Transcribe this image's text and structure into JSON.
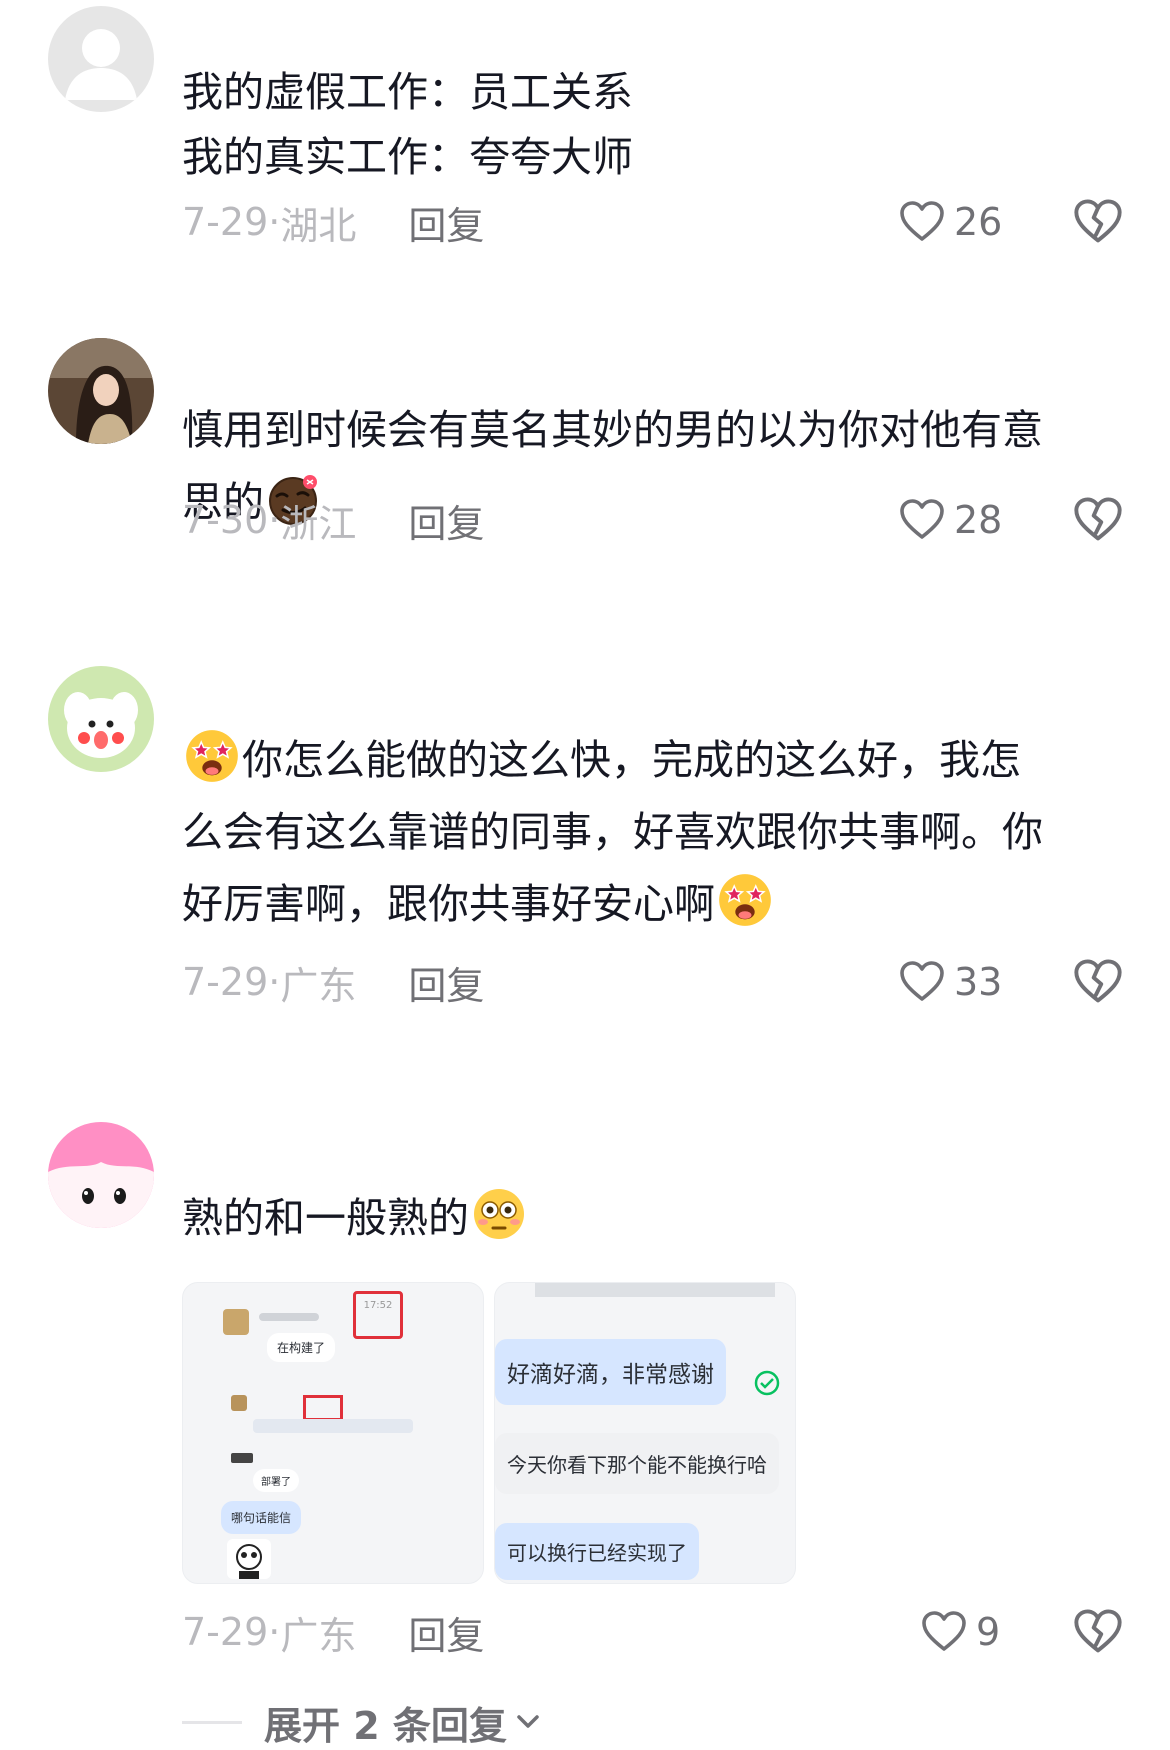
{
  "comments": [
    {
      "lines": [
        "我的虚假工作：员工关系",
        "我的真实工作：夸夸大师"
      ],
      "date": "7-29",
      "location": "湖北",
      "reply_label": "回复",
      "likes": "26"
    },
    {
      "line1": "慎用到时候会有莫名其妙的男的以为你对他有意",
      "line2": "思的",
      "emoji": "smirk-emoji",
      "date": "7-30",
      "location": "浙江",
      "reply_label": "回复",
      "likes": "28"
    },
    {
      "line1": "你怎么能做的这么快，完成的这么好，我怎",
      "line2": "么会有这么靠谱的同事，好喜欢跟你共事啊。你",
      "line3": "好厉害啊，跟你共事好安心啊",
      "emoji": "starstruck-emoji",
      "date": "7-29",
      "location": "广东",
      "reply_label": "回复",
      "likes": "33"
    },
    {
      "text": "熟的和一般熟的",
      "emoji": "flushed-emoji",
      "date": "7-29",
      "location": "广东",
      "reply_label": "回复",
      "likes": "9",
      "image1": {
        "time": "17:52",
        "msg1": "在构建了",
        "msg2": "部署了",
        "msg3": "哪句话能信"
      },
      "image2": {
        "msg1": "好滴好滴，非常感谢",
        "msg2": "今天你看下那个能不能换行哈",
        "msg3": "可以换行已经实现了"
      }
    }
  ],
  "expand_replies": "展开 2 条回复",
  "colors": {
    "text": "#161823",
    "meta": "#b9b9bd",
    "secondary": "#707075",
    "bubble_blue": "#d6e6ff"
  }
}
